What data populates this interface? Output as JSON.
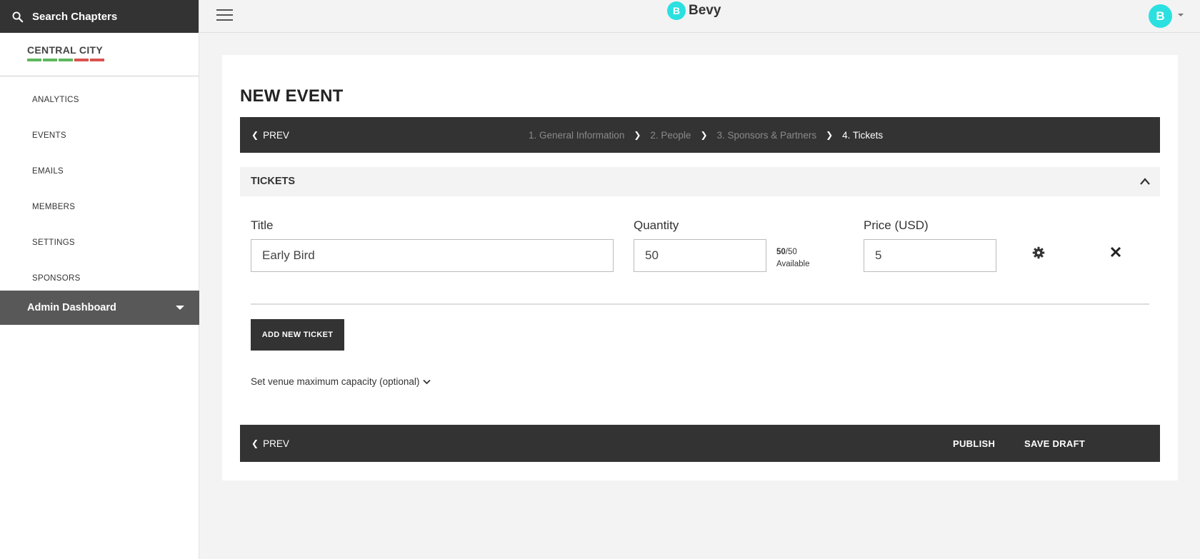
{
  "sidebar": {
    "search_label": "Search Chapters",
    "chapter_name": "CENTRAL CITY",
    "chapter_bar_colors": [
      "#5cb85c",
      "#5cb85c",
      "#5cb85c",
      "#d9534f",
      "#d9534f"
    ],
    "nav": [
      "ANALYTICS",
      "EVENTS",
      "EMAILS",
      "MEMBERS",
      "SETTINGS",
      "SPONSORS"
    ],
    "admin_label": "Admin Dashboard"
  },
  "topbar": {
    "logo_mark": "B",
    "logo_text": "Bevy",
    "avatar_letter": "B",
    "accent_color": "#2be0e0"
  },
  "page": {
    "title": "NEW EVENT",
    "prev_label": "PREV",
    "steps": [
      "1. General Information",
      "2. People",
      "3. Sponsors & Partners",
      "4. Tickets"
    ],
    "active_step": 3,
    "section_title": "TICKETS"
  },
  "ticket": {
    "title_label": "Title",
    "title_value": "Early Bird",
    "quantity_label": "Quantity",
    "quantity_value": "50",
    "available_count": "50",
    "available_total": "/50",
    "available_label": "Available",
    "price_label": "Price (USD)",
    "price_value": "5"
  },
  "actions": {
    "add_ticket": "ADD NEW TICKET",
    "capacity": "Set venue maximum capacity (optional)",
    "publish": "PUBLISH",
    "save_draft": "SAVE DRAFT"
  }
}
